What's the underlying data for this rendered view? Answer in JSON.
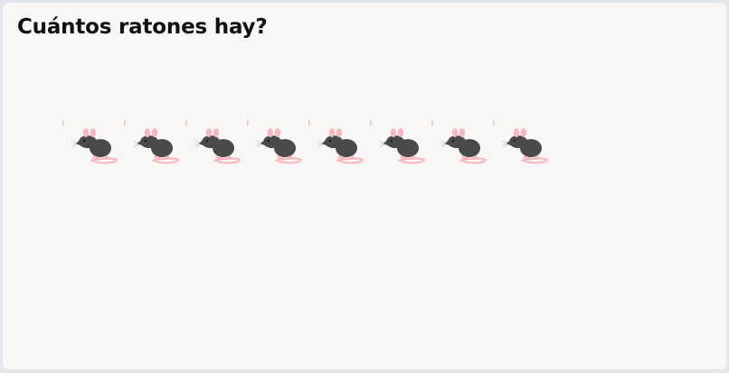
{
  "question": {
    "text": "Cuántos ratones hay?"
  },
  "mice": {
    "count": 8,
    "icon": "mouse-icon",
    "colors": {
      "body": "#4a4a4a",
      "ear": "#f7b9bf",
      "tail": "#f7b9bf",
      "whisker": "#cccccc"
    }
  }
}
